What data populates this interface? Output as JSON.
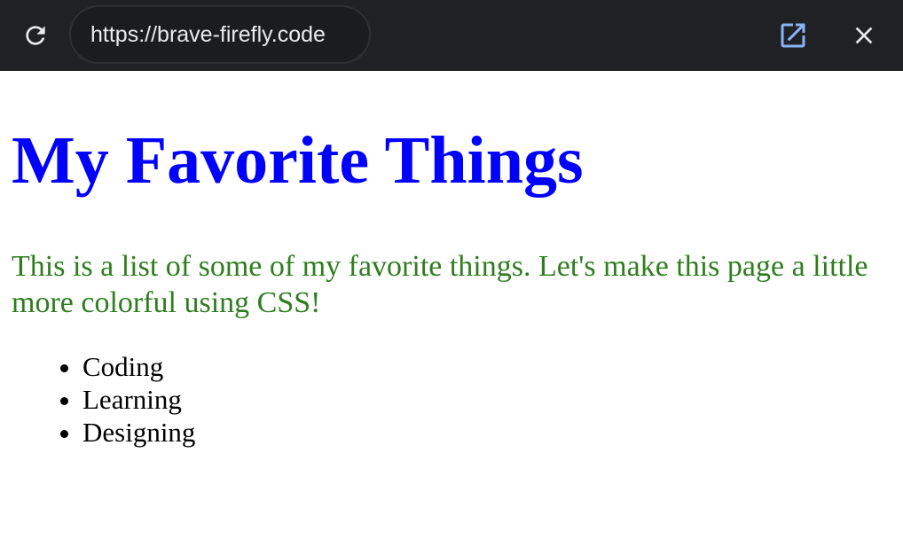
{
  "browser": {
    "url": "https://brave-firefly.code",
    "reload_icon": "reload-icon",
    "open_icon": "open-in-new-icon",
    "close_icon": "close-icon",
    "colors": {
      "toolbar_bg": "#202124",
      "url_text": "#e8eaed",
      "open_icon": "#8ab4f8"
    }
  },
  "page": {
    "title": "My Favorite Things",
    "intro": "This is a list of some of my favorite things. Let's make this page a little more colorful using CSS!",
    "items": [
      {
        "label": "Coding"
      },
      {
        "label": "Learning"
      },
      {
        "label": "Designing"
      }
    ],
    "colors": {
      "title": "#0000ff",
      "intro": "#2e7d1e",
      "list": "#000000"
    }
  }
}
